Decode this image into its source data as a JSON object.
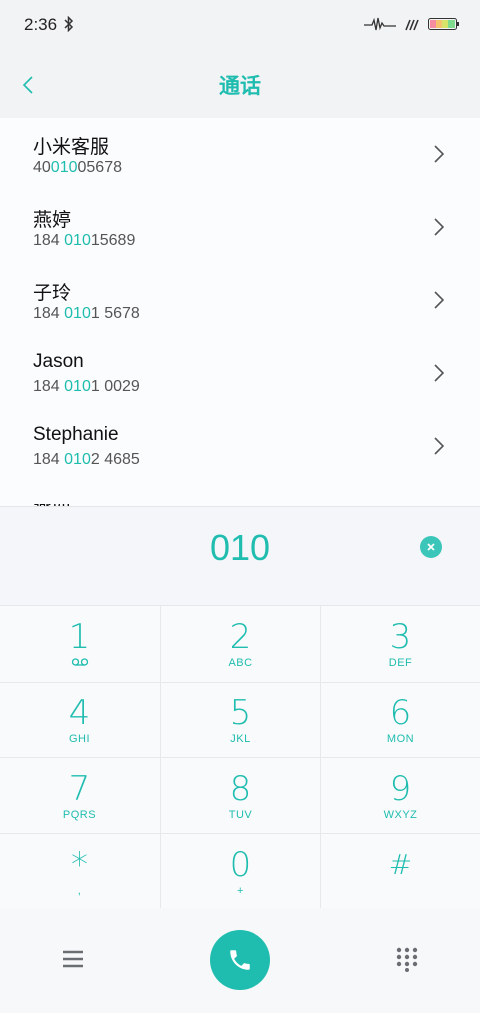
{
  "status": {
    "time": "2:36"
  },
  "header": {
    "title": "通话"
  },
  "contacts": [
    {
      "name": "小米客服",
      "num_pre": "40",
      "num_hl": "010",
      "num_post": "05678"
    },
    {
      "name": "燕婷",
      "num_pre": "184 ",
      "num_hl": "010",
      "num_post": "15689"
    },
    {
      "name": "子玲",
      "num_pre": "184 ",
      "num_hl": "010",
      "num_post": "1 5678"
    },
    {
      "name": "Jason",
      "num_pre": "184 ",
      "num_hl": "010",
      "num_post": "1 0029"
    },
    {
      "name": "Stephanie",
      "num_pre": "184 ",
      "num_hl": "010",
      "num_post": "2 4685"
    }
  ],
  "partial_contact": "燕西",
  "dialer": {
    "input": "010"
  },
  "keys": [
    {
      "digit": "1",
      "letters": ""
    },
    {
      "digit": "2",
      "letters": "ABC"
    },
    {
      "digit": "3",
      "letters": "DEF"
    },
    {
      "digit": "4",
      "letters": "GHI"
    },
    {
      "digit": "5",
      "letters": "JKL"
    },
    {
      "digit": "6",
      "letters": "MON"
    },
    {
      "digit": "7",
      "letters": "PQRS"
    },
    {
      "digit": "8",
      "letters": "TUV"
    },
    {
      "digit": "9",
      "letters": "WXYZ"
    },
    {
      "digit": "*",
      "letters": ","
    },
    {
      "digit": "0",
      "letters": "+"
    },
    {
      "digit": "#",
      "letters": ""
    }
  ],
  "colors": {
    "accent": "#1fbdaf"
  },
  "icons": {
    "back": "chevron-left-icon",
    "row": "chevron-right-icon",
    "clear": "clear-icon",
    "voicemail": "voicemail-icon",
    "menu": "menu-icon",
    "call": "phone-icon",
    "keypad": "dialpad-icon"
  }
}
